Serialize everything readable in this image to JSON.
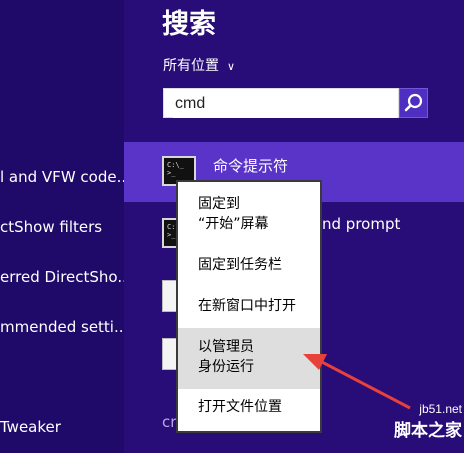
{
  "header": {
    "title": "搜索"
  },
  "scope": {
    "label": "所有位置",
    "chevron_icon": "chevron-down-icon"
  },
  "search": {
    "value": "cmd",
    "icon": "search-icon"
  },
  "left_results": [
    {
      "label": "l and VFW code..."
    },
    {
      "label": "ctShow filters"
    },
    {
      "label": "erred DirectSho..."
    },
    {
      "label": "mmended setti..."
    },
    {
      "label": "Tweaker"
    }
  ],
  "results": [
    {
      "label": "命令提示符",
      "icon": "cmd-icon"
    },
    {
      "label": "nd prompt",
      "icon": "cmd-icon"
    },
    {
      "label": "",
      "icon": "document-icon"
    },
    {
      "label": "",
      "icon": "document-icon"
    },
    {
      "label": "cr",
      "icon": ""
    }
  ],
  "context_menu": {
    "items": [
      {
        "line1": "固定到",
        "line2": "“开始”屏幕"
      },
      {
        "line1": "固定到任务栏",
        "line2": ""
      },
      {
        "line1": "在新窗口中打开",
        "line2": ""
      },
      {
        "line1": "以管理员",
        "line2": "身份运行",
        "highlighted": true
      },
      {
        "line1": "打开文件位置",
        "line2": ""
      }
    ]
  },
  "annotation": {
    "color": "#e8413b"
  },
  "watermark": {
    "domain": "jb51.net",
    "site": "脚本之家"
  },
  "colors": {
    "left_bg": "#1f0a6a",
    "right_bg": "#280c78",
    "selected": "#5a33c8",
    "search_btn": "#4e2fc2"
  }
}
